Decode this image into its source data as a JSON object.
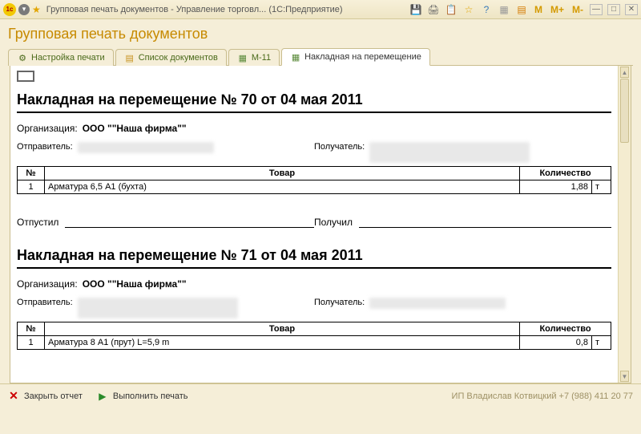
{
  "titlebar": {
    "title": "Групповая печать документов - Управление торговл...   (1С:Предприятие)"
  },
  "memory_buttons": [
    "M",
    "M+",
    "M-"
  ],
  "main_title": "Групповая печать документов",
  "tabs": [
    {
      "label": "Настройка печати"
    },
    {
      "label": "Список документов"
    },
    {
      "label": "М-11"
    },
    {
      "label": "Накладная на перемещение"
    }
  ],
  "documents": [
    {
      "title": "Накладная на перемещение № 70 от 04 мая 2011",
      "org_label": "Организация:",
      "org_value": "ООО \"\"Наша фирма\"\"",
      "sender_label": "Отправитель:",
      "receiver_label": "Получатель:",
      "table": {
        "headers": [
          "№",
          "Товар",
          "Количество"
        ],
        "rows": [
          {
            "n": "1",
            "name": "Арматура 6,5 А1 (бухта)",
            "qty": "1,88",
            "unit": "т"
          }
        ]
      },
      "sign_out": "Отпустил",
      "sign_in": "Получил"
    },
    {
      "title": "Накладная на перемещение № 71 от 04 мая 2011",
      "org_label": "Организация:",
      "org_value": "ООО \"\"Наша фирма\"\"",
      "sender_label": "Отправитель:",
      "receiver_label": "Получатель:",
      "table": {
        "headers": [
          "№",
          "Товар",
          "Количество"
        ],
        "rows": [
          {
            "n": "1",
            "name": "Арматура 8 А1 (прут)  L=5,9 m",
            "qty": "0,8",
            "unit": "т"
          }
        ]
      }
    }
  ],
  "bottom": {
    "close_label": "Закрыть отчет",
    "print_label": "Выполнить печать",
    "credit": "ИП Владислав Котвицкий +7 (988) 411 20 77"
  }
}
